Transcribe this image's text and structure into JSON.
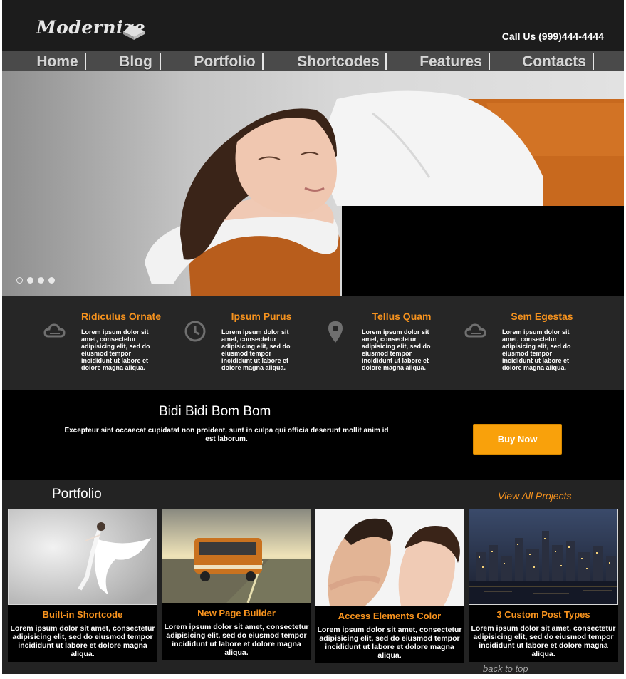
{
  "header": {
    "logo_text": "Modernize",
    "phone": "Call Us (999)444-4444"
  },
  "nav": {
    "items": [
      "Home",
      "Blog",
      "Portfolio",
      "Shortcodes",
      "Features",
      "Contacts"
    ]
  },
  "slider": {
    "dot_count": 4
  },
  "features": [
    {
      "title": "Ridiculus Ornate",
      "icon": "cloud-icon",
      "text": "Lorem ipsum dolor sit amet, consectetur adipisicing elit, sed do eiusmod tempor incididunt ut labore et dolore magna aliqua."
    },
    {
      "title": "Ipsum Purus",
      "icon": "clock-icon",
      "text": "Lorem ipsum dolor sit amet, consectetur adipisicing elit, sed do eiusmod tempor incididunt ut labore et dolore magna aliqua."
    },
    {
      "title": "Tellus Quam",
      "icon": "map-pin-icon",
      "text": "Lorem ipsum dolor sit amet, consectetur adipisicing elit, sed do eiusmod tempor incididunt ut labore et dolore magna aliqua."
    },
    {
      "title": "Sem Egestas",
      "icon": "cloud-icon",
      "text": "Lorem ipsum dolor sit amet, consectetur adipisicing elit, sed do eiusmod tempor incididunt ut labore et dolore magna aliqua."
    }
  ],
  "banner": {
    "title": "Bidi Bidi Bom Bom",
    "text": "Excepteur sint occaecat cupidatat non proident, sunt in culpa qui officia deserunt mollit anim id est laborum.",
    "button": "Buy Now"
  },
  "portfolio": {
    "title": "Portfolio",
    "view_all": "View All Projects",
    "back_to_top": "back to top",
    "items": [
      {
        "title": "Built-in Shortcode",
        "text": "Lorem ipsum dolor sit amet, consectetur adipisicing elit, sed do eiusmod tempor incididunt ut labore et dolore magna aliqua."
      },
      {
        "title": "New Page Builder",
        "text": "Lorem ipsum dolor sit amet, consectetur adipisicing elit, sed do eiusmod tempor incididunt ut labore et dolore magna aliqua."
      },
      {
        "title": "Access Elements Color",
        "text": "Lorem ipsum dolor sit amet, consectetur adipisicing elit, sed do eiusmod tempor incididunt ut labore et dolore magna aliqua."
      },
      {
        "title": "3 Custom Post Types",
        "text": "Lorem ipsum dolor sit amet, consectetur adipisicing elit, sed do eiusmod tempor incididunt ut labore et dolore magna aliqua."
      }
    ]
  },
  "colors": {
    "accent": "#f7931e",
    "button": "#f9a10b",
    "background": "#1b1b1b"
  }
}
